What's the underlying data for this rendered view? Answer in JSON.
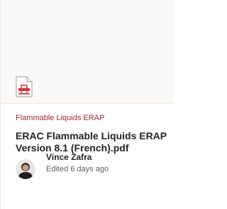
{
  "card": {
    "category": "Flammable Liquids ERAP",
    "title": "ERAC Flammable Liquids ERAP Version 8.1 (French).pdf",
    "file_type_icon": "pdf-file-icon",
    "author": {
      "name": "Vince Zafra",
      "activity": "Edited 6 days ago",
      "avatar_icon": "avatar"
    }
  },
  "colors": {
    "category_text": "#a4262c",
    "pdf_red": "#d13438",
    "preview_background": "#faf9f8"
  }
}
